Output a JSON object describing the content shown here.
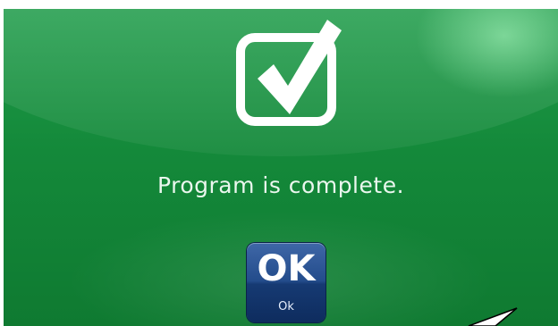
{
  "dialog": {
    "message": "Program is complete.",
    "icon": "checkbox-checked-icon",
    "accent_color": "#149040"
  },
  "ok_button": {
    "big_label": "OK",
    "small_label": "Ok",
    "color": "#234c8b"
  },
  "cursor": {
    "icon": "pointer-arrow-icon"
  }
}
